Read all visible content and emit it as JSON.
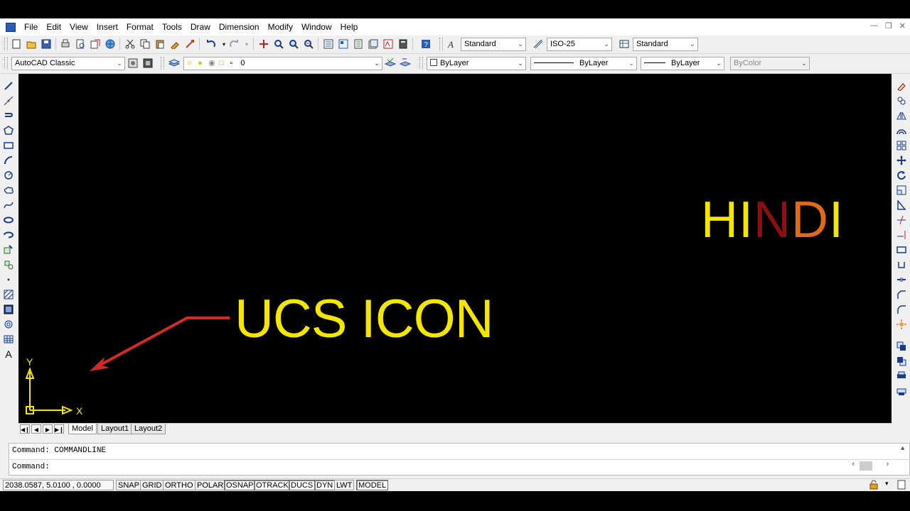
{
  "menu": {
    "items": [
      "File",
      "Edit",
      "View",
      "Insert",
      "Format",
      "Tools",
      "Draw",
      "Dimension",
      "Modify",
      "Window",
      "Help"
    ]
  },
  "styles_toolbar": {
    "text_style": "Standard",
    "dim_style": "ISO-25",
    "table_style": "Standard"
  },
  "workspace": {
    "name": "AutoCAD Classic"
  },
  "layers": {
    "current": "0"
  },
  "properties": {
    "color": "ByLayer",
    "linetype": "ByLayer",
    "lineweight": "ByLayer",
    "plot_style": "ByColor"
  },
  "overlay": {
    "title": "UCS ICON",
    "hindi_letters": [
      "H",
      "I",
      "N",
      "D",
      "I"
    ],
    "hindi_colors": [
      "#f4e600",
      "#f4e600",
      "#8b0f14",
      "#e06a18",
      "#f4e600"
    ],
    "arrow_color": "#d42a24",
    "title_color": "#f4e600"
  },
  "ucs": {
    "x_label": "X",
    "y_label": "Y",
    "color": "#f4e600"
  },
  "layout_tabs": [
    "Model",
    "Layout1",
    "Layout2"
  ],
  "command": {
    "history": "Command: COMMANDLINE",
    "prompt": "Command:"
  },
  "status": {
    "coordinates": "2038.0587, 5.0100  , 0.0000",
    "buttons": [
      "SNAP",
      "GRID",
      "ORTHO",
      "POLAR",
      "OSNAP",
      "OTRACK",
      "DUCS",
      "DYN",
      "LWT",
      "MODEL"
    ],
    "active": [
      "OSNAP",
      "OTRACK",
      "DUCS",
      "DYN",
      "MODEL"
    ]
  }
}
